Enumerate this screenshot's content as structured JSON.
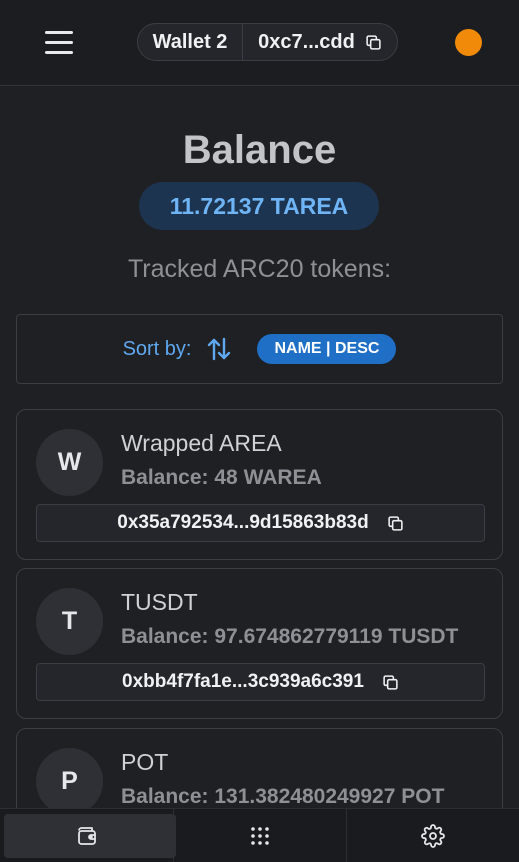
{
  "header": {
    "wallet_name": "Wallet 2",
    "wallet_address": "0xc7...cdd",
    "menu_icon": "hamburger-menu-icon",
    "copy_icon": "copy-icon",
    "status_color": "#f18a09"
  },
  "balance": {
    "title": "Balance",
    "amount": "11.72137 TAREA"
  },
  "tracked": {
    "title": "Tracked ARC20 tokens:"
  },
  "sort": {
    "label": "Sort by:",
    "icon": "sort-arrows-icon",
    "badge": "NAME | DESC"
  },
  "tokens": [
    {
      "initial": "W",
      "name": "Wrapped AREA",
      "balance": "Balance: 48 WAREA",
      "address": "0x35a792534...9d15863b83d"
    },
    {
      "initial": "T",
      "name": "TUSDT",
      "balance": "Balance: 97.674862779119 TUSDT",
      "address": "0xbb4f7fa1e...3c939a6c391"
    },
    {
      "initial": "P",
      "name": "POT",
      "balance": "Balance: 131.382480249927 POT",
      "address": ""
    }
  ],
  "bottom_nav": {
    "items": [
      {
        "icon": "wallet-icon",
        "active": true
      },
      {
        "icon": "apps-grid-icon",
        "active": false
      },
      {
        "icon": "settings-gear-icon",
        "active": false
      }
    ]
  },
  "colors": {
    "accent": "#1e6fc5",
    "balance_text": "#6fb4f5",
    "background": "#1f2024"
  }
}
